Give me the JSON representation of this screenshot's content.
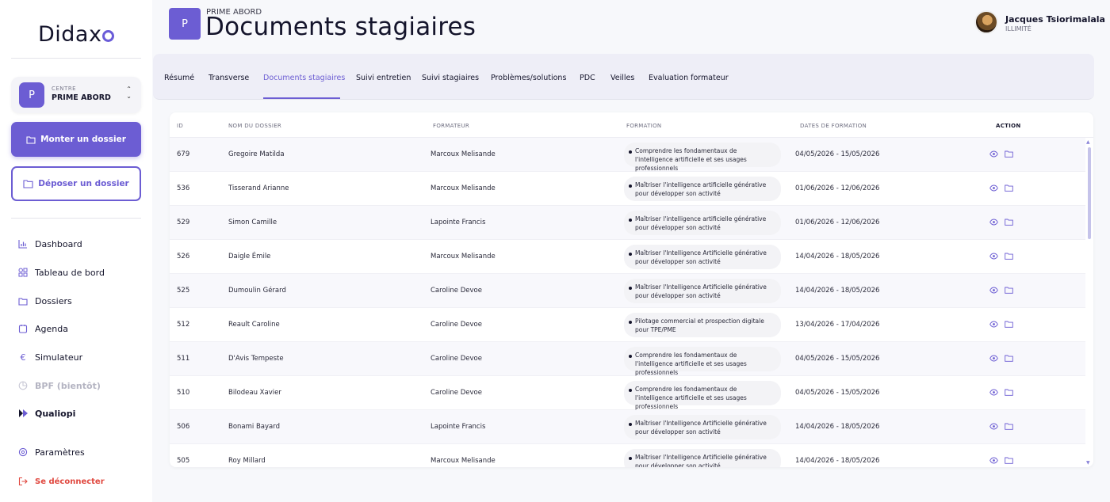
{
  "brand": {
    "logo_text": "Didax"
  },
  "centre": {
    "label": "CENTRE",
    "badge": "P",
    "name": "PRIME ABORD"
  },
  "sidebar": {
    "primary_button": "Monter un dossier",
    "secondary_button": "Déposer un dossier",
    "items": [
      {
        "label": "Dashboard",
        "icon": "bar-chart-icon"
      },
      {
        "label": "Tableau de bord",
        "icon": "dashboard-grid-icon"
      },
      {
        "label": "Dossiers",
        "icon": "folder-icon"
      },
      {
        "label": "Agenda",
        "icon": "calendar-icon"
      },
      {
        "label": "Simulateur",
        "icon": "euro-icon"
      },
      {
        "label": "BPF (bientôt)",
        "icon": "pie-chart-icon"
      },
      {
        "label": "Qualiopi",
        "icon": "qualiopi-icon"
      },
      {
        "label": "Paramètres",
        "icon": "gear-icon"
      },
      {
        "label": "Se déconnecter",
        "icon": "logout-icon"
      }
    ]
  },
  "header": {
    "badge": "P",
    "subtitle": "PRIME ABORD",
    "title": "Documents stagiaires"
  },
  "user": {
    "name": "Jacques Tsiorimalala",
    "role": "ILLIMITÉ"
  },
  "tabs": [
    {
      "label": "Résumé"
    },
    {
      "label": "Transverse"
    },
    {
      "label": "Documents stagiaires"
    },
    {
      "label": "Suivi entretien"
    },
    {
      "label": "Suivi stagiaires"
    },
    {
      "label": "Problèmes/solutions"
    },
    {
      "label": "PDC"
    },
    {
      "label": "Veilles"
    },
    {
      "label": "Evaluation formateur"
    }
  ],
  "table": {
    "columns": {
      "id": "ID",
      "nom": "NOM DU DOSSIER",
      "formateur": "FORMATEUR",
      "formation": "FORMATION",
      "dates": "DATES DE FORMATION",
      "action": "ACTION"
    },
    "rows": [
      {
        "id": "679",
        "nom": "Gregoire Matilda",
        "formateur": "Marcoux Melisande",
        "formation": "Comprendre les fondamentaux de l'intelligence artificielle et ses usages professionnels",
        "dates": "04/05/2026 - 15/05/2026"
      },
      {
        "id": "536",
        "nom": "Tisserand Arianne",
        "formateur": "Marcoux Melisande",
        "formation": "Maîtriser l'intelligence artificielle générative pour développer son activité",
        "dates": "01/06/2026 - 12/06/2026"
      },
      {
        "id": "529",
        "nom": "Simon Camille",
        "formateur": "Lapointe Francis",
        "formation": "Maîtriser l'intelligence artificielle générative pour développer son activité",
        "dates": "01/06/2026 - 12/06/2026"
      },
      {
        "id": "526",
        "nom": "Daigle Émile",
        "formateur": "Marcoux Melisande",
        "formation": "Maîtriser l'Intelligence Artificielle générative pour développer son activité",
        "dates": "14/04/2026 - 18/05/2026"
      },
      {
        "id": "525",
        "nom": "Dumoulin Gérard",
        "formateur": "Caroline Devoe",
        "formation": "Maîtriser l'Intelligence Artificielle générative pour développer son activité",
        "dates": "14/04/2026 - 18/05/2026"
      },
      {
        "id": "512",
        "nom": "Reault Caroline",
        "formateur": "Caroline Devoe",
        "formation": "Pilotage commercial et prospection digitale pour TPE/PME",
        "dates": "13/04/2026 - 17/04/2026"
      },
      {
        "id": "511",
        "nom": "D'Avis Tempeste",
        "formateur": "Caroline Devoe",
        "formation": "Comprendre les fondamentaux de l'intelligence artificielle et ses usages professionnels",
        "dates": "04/05/2026 - 15/05/2026"
      },
      {
        "id": "510",
        "nom": "Bilodeau Xavier",
        "formateur": "Caroline Devoe",
        "formation": "Comprendre les fondamentaux de l'intelligence artificielle et ses usages professionnels",
        "dates": "04/05/2026 - 15/05/2026"
      },
      {
        "id": "506",
        "nom": "Bonami Bayard",
        "formateur": "Lapointe Francis",
        "formation": "Maîtriser l'Intelligence Artificielle générative pour développer son activité",
        "dates": "14/04/2026 - 18/05/2026"
      },
      {
        "id": "505",
        "nom": "Roy Millard",
        "formateur": "Marcoux Melisande",
        "formation": "Maîtriser l'Intelligence Artificielle générative pour développer son activité",
        "dates": "14/04/2026 - 18/05/2026"
      }
    ]
  },
  "colors": {
    "accent": "#6c5dd3",
    "danger": "#e0483f",
    "text": "#14142b"
  }
}
